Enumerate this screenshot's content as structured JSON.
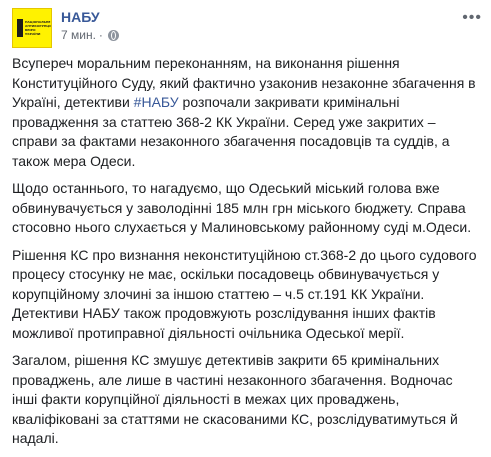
{
  "header": {
    "page_name": "НАБУ",
    "timestamp": "7 мин.",
    "separator": "·",
    "avatar_text": "НАЦІОНАЛЬНЕ\nАНТИКОРУПЦІЙНЕ\nБЮРО УКРАЇНИ",
    "globe_icon": "globe-icon",
    "more_icon": "more-options-icon"
  },
  "colors": {
    "page_name": "#385898",
    "hashtag": "#385898",
    "text": "#1c1e21",
    "meta": "#616770",
    "avatar_bg": "#fff200"
  },
  "post": {
    "p1_before": "Всупереч моральним переконанням, на виконання рішення Конституційного Суду, який фактично узаконив незаконне збагачення в Україні, детективи ",
    "p1_hashtag": "#НАБУ",
    "p1_after": " розпочали закривати кримінальні провадження за статтею 368-2 КК України. Серед уже закритих – справи за фактами незаконного збагачення посадовців та суддів, а також мера Одеси.",
    "p2": "Щодо останнього, то нагадуємо, що Одеський міський голова вже обвинувачується у заволодінні 185 млн грн міського бюджету. Справа стосовно нього слухається у Малиновському районному суді м.Одеси.",
    "p3": "Рішення КС про визнання неконституційною ст.368-2 до цього судового процесу стосунку не має, оскільки посадовець обвинувачується у корупційному злочині за іншою статтею – ч.5 ст.191 КК України. Детективи НАБУ також продовжують розслідування інших фактів можливої протиправної діяльності очільника Одеської мерії.",
    "p4": "Загалом, рішення КС змушує детективів закрити 65 кримінальних проваджень, але лише в частині незаконного збагачення. Водночас інші факти корупційної діяльності в межах цих проваджень, кваліфіковані за статтями не скасованими КС, розслідуватимуться й надалі."
  }
}
